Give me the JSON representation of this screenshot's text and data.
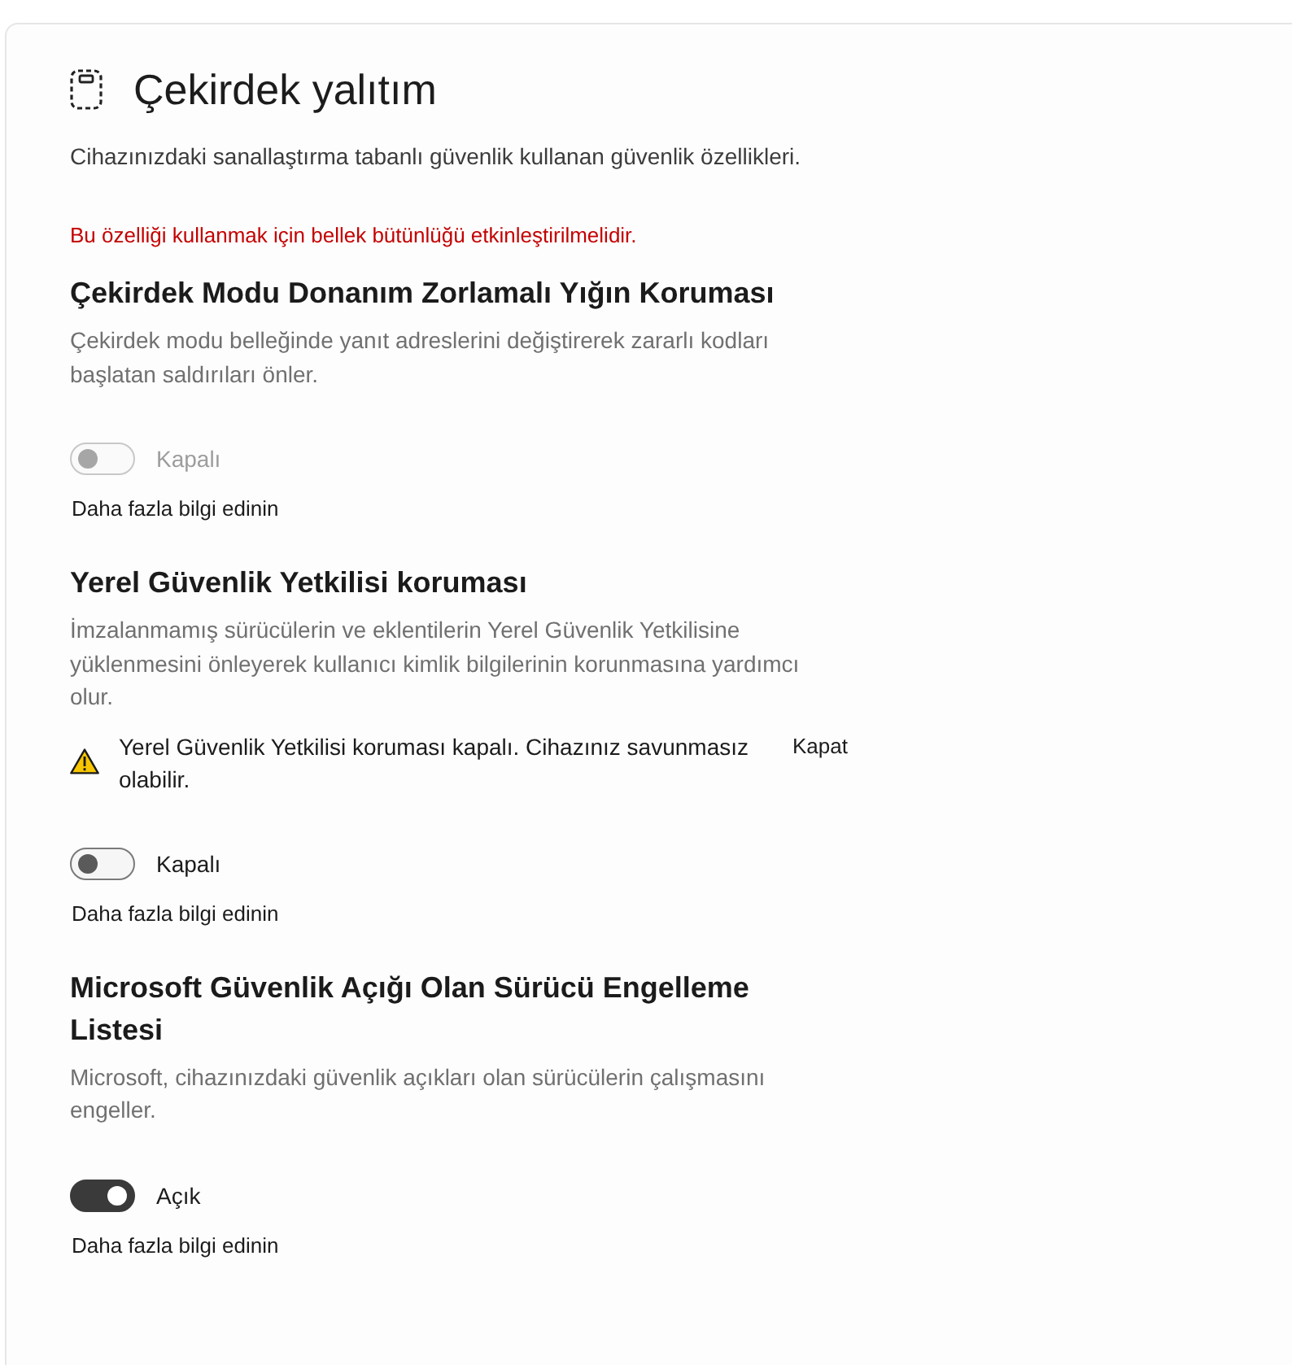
{
  "page": {
    "title": "Çekirdek yalıtım",
    "description": "Cihazınızdaki sanallaştırma tabanlı güvenlik kullanan güvenlik özellikleri."
  },
  "sections": [
    {
      "notice": "Bu özelliği kullanmak için bellek bütünlüğü etkinleştirilmelidir.",
      "heading": "Çekirdek Modu Donanım Zorlamalı Yığın Koruması",
      "description": "Çekirdek modu belleğinde yanıt adreslerini değiştirerek zararlı kodları başlatan saldırıları önler.",
      "toggle": {
        "on": false,
        "disabled": true,
        "label": "Kapalı"
      },
      "link": "Daha fazla bilgi edinin"
    },
    {
      "heading": "Yerel Güvenlik Yetkilisi koruması",
      "description": "İmzalanmamış sürücülerin ve eklentilerin Yerel Güvenlik Yetkilisine yüklenmesini önleyerek kullanıcı kimlik bilgilerinin korunmasına yardımcı olur.",
      "alert": {
        "kind": "warning",
        "text": "Yerel Güvenlik Yetkilisi koruması kapalı. Cihazınız savunmasız olabilir.",
        "action": "Kapat"
      },
      "toggle": {
        "on": false,
        "disabled": false,
        "label": "Kapalı"
      },
      "link": "Daha fazla bilgi edinin"
    },
    {
      "heading": "Microsoft Güvenlik Açığı Olan Sürücü Engelleme Listesi",
      "description": "Microsoft, cihazınızdaki güvenlik açıkları olan sürücülerin çalışmasını engeller.",
      "toggle": {
        "on": true,
        "disabled": false,
        "label": "Açık"
      },
      "link": "Daha fazla bilgi edinin"
    }
  ]
}
